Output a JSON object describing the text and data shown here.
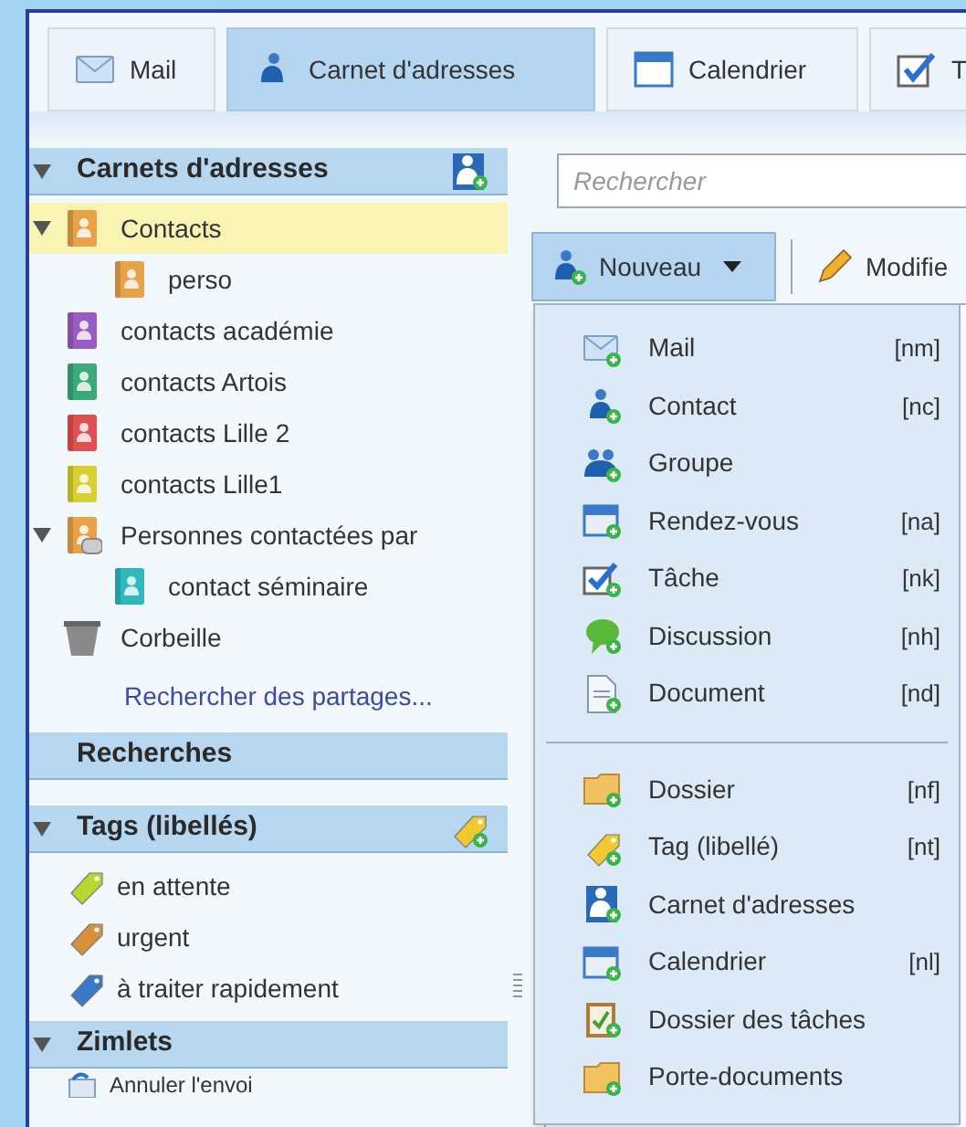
{
  "tabs": [
    {
      "label": "Mail",
      "selected": false
    },
    {
      "label": "Carnet d'adresses",
      "selected": true
    },
    {
      "label": "Calendrier",
      "selected": false
    },
    {
      "label": "T",
      "selected": false
    }
  ],
  "sidebar": {
    "address_books": {
      "title": "Carnets d'adresses",
      "expanded": true,
      "items": [
        {
          "label": "Contacts",
          "kind": "book",
          "color": "#e8a24a",
          "selected": true,
          "expanded": true,
          "children": [
            {
              "label": "perso",
              "kind": "book",
              "color": "#e8a24a",
              "selected": false
            }
          ]
        },
        {
          "label": "contacts académie",
          "kind": "book",
          "color": "#9a5cc0",
          "selected": false
        },
        {
          "label": "contacts Artois",
          "kind": "book",
          "color": "#3aaa7a",
          "selected": false
        },
        {
          "label": "contacts Lille 2",
          "kind": "book",
          "color": "#e05050",
          "selected": false
        },
        {
          "label": "contacts Lille1",
          "kind": "book",
          "color": "#d8d030",
          "selected": false
        },
        {
          "label": "Personnes contactées par",
          "kind": "shared",
          "color": "#e8a24a",
          "selected": false,
          "expanded": true,
          "children": [
            {
              "label": "contact séminaire",
              "kind": "book",
              "color": "#30b8c0",
              "selected": false
            }
          ]
        },
        {
          "label": "Corbeille",
          "kind": "trash",
          "selected": false
        }
      ],
      "link": "Rechercher des partages..."
    },
    "searches": {
      "title": "Recherches"
    },
    "tags": {
      "title": "Tags (libellés)",
      "expanded": true,
      "items": [
        {
          "label": "en attente",
          "color": "#b8d830"
        },
        {
          "label": "urgent",
          "color": "#d8903a"
        },
        {
          "label": "à traiter rapidement",
          "color": "#3a78c8"
        }
      ]
    },
    "zimlets": {
      "title": "Zimlets",
      "expanded": true,
      "items": [
        {
          "label": "Annuler l'envoi"
        }
      ]
    }
  },
  "search": {
    "placeholder": "Rechercher"
  },
  "toolbar": {
    "new_button": "Nouveau",
    "edit_button": "Modifie"
  },
  "new_menu": {
    "groups": [
      [
        {
          "label": "Mail",
          "shortcut": "[nm]"
        },
        {
          "label": "Contact",
          "shortcut": "[nc]"
        },
        {
          "label": "Groupe"
        },
        {
          "label": "Rendez-vous",
          "shortcut": "[na]"
        },
        {
          "label": "Tâche",
          "shortcut": "[nk]"
        },
        {
          "label": "Discussion",
          "shortcut": "[nh]"
        },
        {
          "label": "Document",
          "shortcut": "[nd]"
        }
      ],
      [
        {
          "label": "Dossier",
          "shortcut": "[nf]"
        },
        {
          "label": "Tag (libellé)",
          "shortcut": "[nt]"
        },
        {
          "label": "Carnet d'adresses"
        },
        {
          "label": "Calendrier",
          "shortcut": "[nl]"
        },
        {
          "label": "Dossier des tâches"
        },
        {
          "label": "Porte-documents"
        }
      ]
    ]
  }
}
